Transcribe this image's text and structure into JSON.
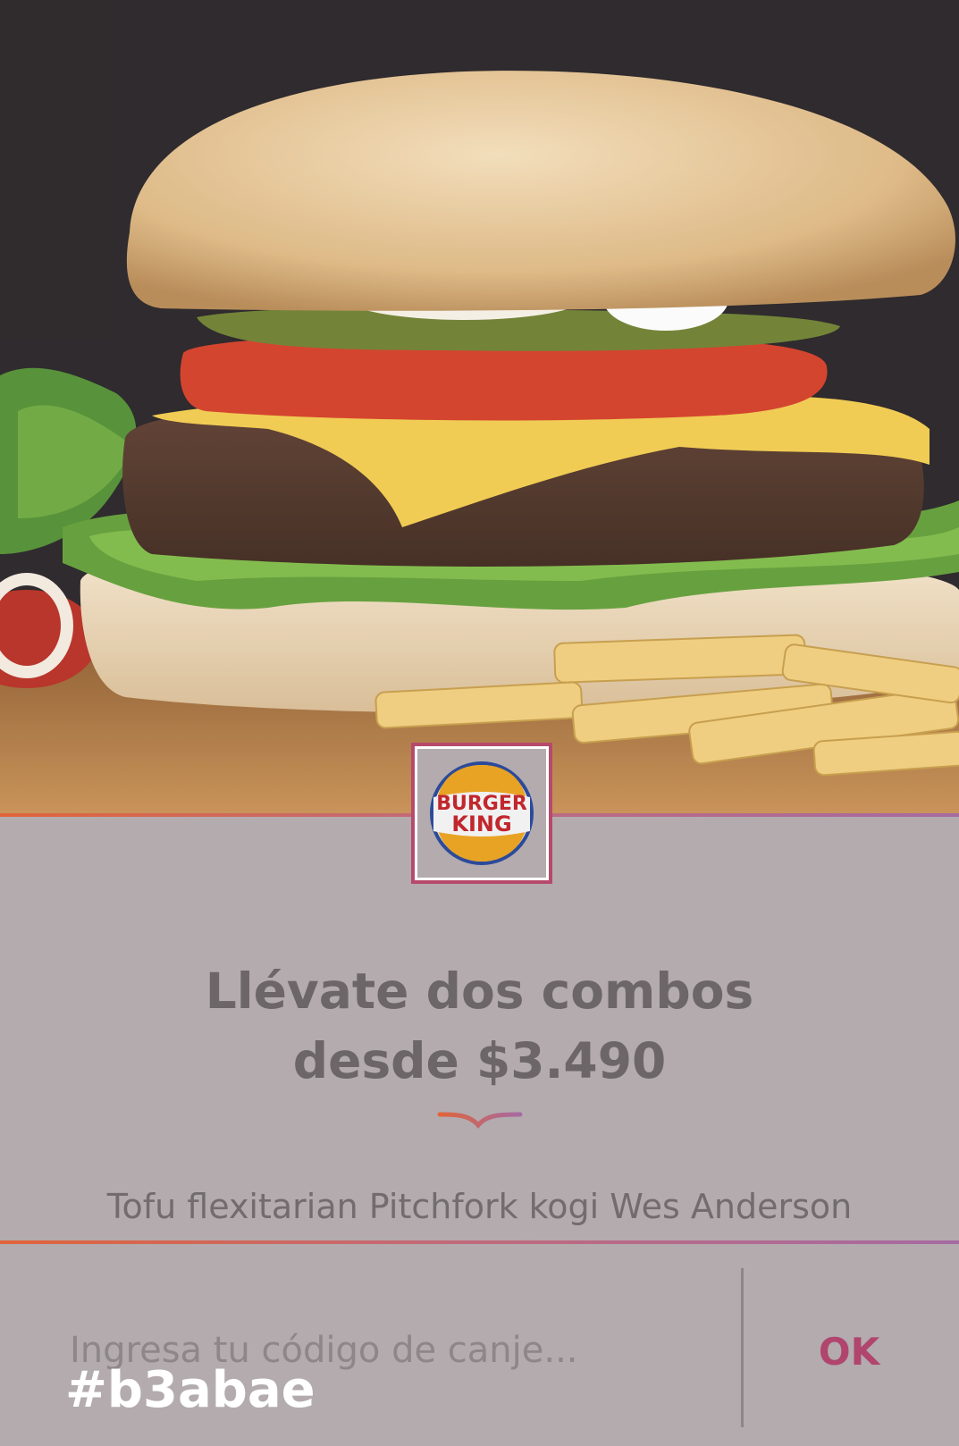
{
  "hero": {
    "image_subject": "hamburger-with-fries-photo"
  },
  "brand": {
    "logo_line1": "BURGER",
    "logo_line2": "KING",
    "accent_color": "#b64a6c"
  },
  "offer": {
    "headline_line1": "Llévate dos combos",
    "headline_line2": "desde $3.490",
    "subtitle": "Tofu flexitarian Pitchfork kogi Wes Anderson"
  },
  "redeem": {
    "placeholder": "Ingresa tu código de canje...",
    "value": "",
    "ok_label": "OK"
  },
  "overlay_label": "#b3abae",
  "colors": {
    "background": "#b3abae",
    "gradient_start": "#e0643a",
    "gradient_end": "#a66aa3",
    "ok_color": "#b0456d"
  }
}
